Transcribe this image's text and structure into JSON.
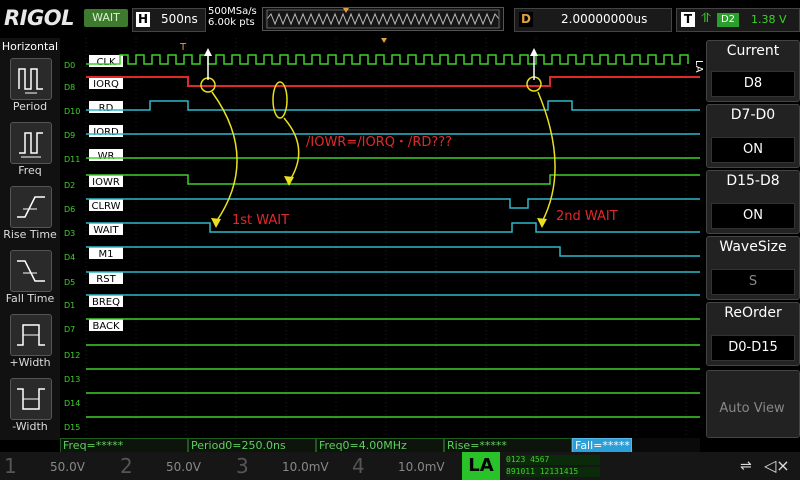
{
  "app": {
    "brand": "RIGOL",
    "run_state": "WAIT"
  },
  "header": {
    "timebase_label": "H",
    "timebase": "500ns",
    "sample_rate": "500MSa/s",
    "memory_depth": "6.00k pts",
    "delay_label": "D",
    "delay": "2.00000000us",
    "trigger_label": "T",
    "trigger_source": "D2",
    "trigger_level": "1.38 V"
  },
  "left_menu": {
    "title": "Horizontal",
    "items": [
      {
        "label": "Period",
        "icon": "period-icon"
      },
      {
        "label": "Freq",
        "icon": "freq-icon"
      },
      {
        "label": "Rise Time",
        "icon": "rise-time-icon"
      },
      {
        "label": "Fall Time",
        "icon": "fall-time-icon"
      },
      {
        "label": "+Width",
        "icon": "positive-width-icon"
      },
      {
        "label": "-Width",
        "icon": "negative-width-icon"
      }
    ]
  },
  "right_menu": {
    "tab": "LA",
    "items": [
      {
        "title": "Current",
        "value": "D8"
      },
      {
        "title": "D7-D0",
        "value": "ON"
      },
      {
        "title": "D15-D8",
        "value": "ON"
      },
      {
        "title": "WaveSize",
        "value": "S"
      },
      {
        "title": "ReOrder",
        "value": "D0-D15"
      },
      {
        "title": "",
        "value": "Auto View"
      }
    ]
  },
  "channels": [
    {
      "ch": "D0",
      "label": "CLK"
    },
    {
      "ch": "D8",
      "label": "IORQ"
    },
    {
      "ch": "D10",
      "label": "RD"
    },
    {
      "ch": "D9",
      "label": "IORD"
    },
    {
      "ch": "D11",
      "label": "WR"
    },
    {
      "ch": "D2",
      "label": "IOWR"
    },
    {
      "ch": "D6",
      "label": "CLRW"
    },
    {
      "ch": "D3",
      "label": "WAIT"
    },
    {
      "ch": "D4",
      "label": "M1"
    },
    {
      "ch": "D5",
      "label": "RST"
    },
    {
      "ch": "D1",
      "label": "BREQ"
    },
    {
      "ch": "D7",
      "label": "BACK"
    },
    {
      "ch": "D12",
      "label": ""
    },
    {
      "ch": "D13",
      "label": ""
    },
    {
      "ch": "D14",
      "label": ""
    },
    {
      "ch": "D15",
      "label": ""
    }
  ],
  "annotations": {
    "formula": "/IOWR=/IORQ・/RD???",
    "first_wait": "1st WAIT",
    "second_wait": "2nd WAIT"
  },
  "measurements": [
    {
      "text": "Freq=*****"
    },
    {
      "text": "Period0=250.0ns"
    },
    {
      "text": "Freq0=4.00MHz"
    },
    {
      "text": "Rise=*****"
    },
    {
      "text": "Fall=*****"
    }
  ],
  "bottom_channels": [
    {
      "num": "1",
      "scale": "50.0V"
    },
    {
      "num": "2",
      "scale": "50.0V"
    },
    {
      "num": "3",
      "scale": "10.0mV"
    },
    {
      "num": "4",
      "scale": "10.0mV"
    }
  ],
  "la_status": {
    "label": "LA",
    "row1": "0123 4567",
    "row2": "891011 12131415"
  },
  "colors": {
    "green": "#3fd02a",
    "cyan": "#2fb7c9",
    "red": "#e02a2a",
    "yellow": "#e8e020",
    "orange": "#e0a040"
  }
}
